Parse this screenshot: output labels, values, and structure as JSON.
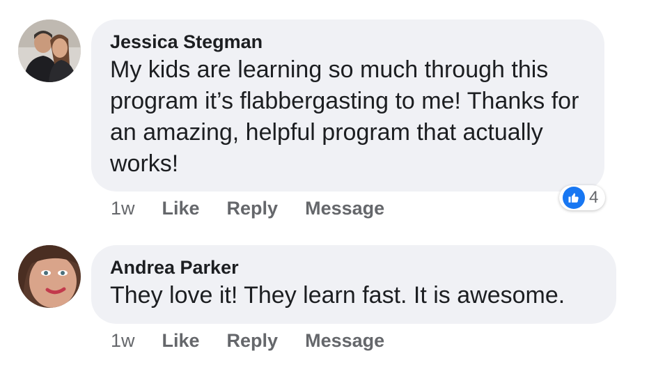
{
  "comments": [
    {
      "author": "Jessica Stegman",
      "text": "My kids are learning so much through this program it’s flabbergasting to me! Thanks for an amazing, helpful program that actually works!",
      "time": "1w",
      "like_label": "Like",
      "reply_label": "Reply",
      "message_label": "Message",
      "reaction_count": "4"
    },
    {
      "author": "Andrea Parker",
      "text": "They love it! They learn fast. It is awesome.",
      "time": "1w",
      "like_label": "Like",
      "reply_label": "Reply",
      "message_label": "Message"
    }
  ],
  "colors": {
    "bubble": "#f0f1f5",
    "like_blue": "#1877f2",
    "meta_gray": "#65676b"
  },
  "icons": {
    "reaction": "thumbs-up-icon"
  }
}
